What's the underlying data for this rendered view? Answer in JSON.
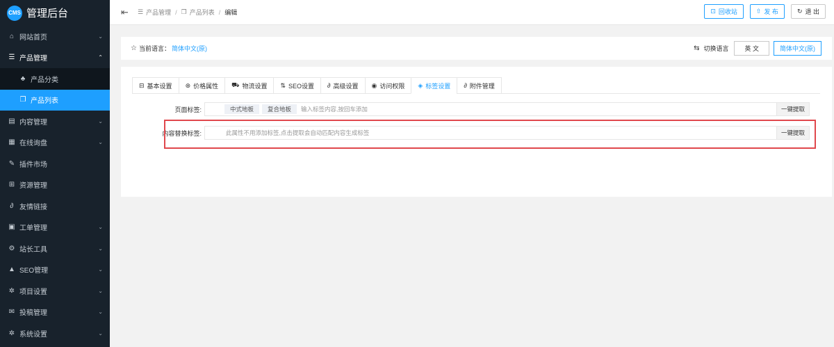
{
  "brand": {
    "logo": "CMS",
    "title": "管理后台"
  },
  "sidebar": {
    "items": [
      {
        "label": "网站首页",
        "icon": "home-icon",
        "arrow": "down"
      },
      {
        "label": "产品管理",
        "icon": "list-icon",
        "arrow": "up",
        "open": true
      },
      {
        "label": "内容管理",
        "icon": "content-icon",
        "arrow": "down"
      },
      {
        "label": "在线询盘",
        "icon": "inquiry-icon",
        "arrow": "down"
      },
      {
        "label": "插件市场",
        "icon": "pin-icon"
      },
      {
        "label": "资源管理",
        "icon": "grid-icon"
      },
      {
        "label": "友情链接",
        "icon": "link-icon"
      },
      {
        "label": "工单管理",
        "icon": "ticket-icon",
        "arrow": "down"
      },
      {
        "label": "站长工具",
        "icon": "tools-icon",
        "arrow": "down"
      },
      {
        "label": "SEO管理",
        "icon": "warning-icon",
        "arrow": "down"
      },
      {
        "label": "项目设置",
        "icon": "gear-icon",
        "arrow": "down"
      },
      {
        "label": "投稿管理",
        "icon": "mail-icon",
        "arrow": "down"
      },
      {
        "label": "系统设置",
        "icon": "gear-icon",
        "arrow": "down"
      }
    ],
    "sub_items": [
      {
        "label": "产品分类",
        "icon": "category-icon"
      },
      {
        "label": "产品列表",
        "icon": "copy-icon",
        "active": true
      }
    ]
  },
  "header": {
    "breadcrumb": [
      "产品管理",
      "产品列表",
      "编辑"
    ],
    "buttons": {
      "recycle": "回收站",
      "publish": "发 布",
      "logout": "退 出"
    }
  },
  "language": {
    "current_label": "当前语言：",
    "current_value": "简体中文(原)",
    "switch_label": "切换语言",
    "options": [
      "英 文",
      "简体中文(原)"
    ]
  },
  "tabs": [
    "基本设置",
    "价格属性",
    "物流设置",
    "SEO设置",
    "高级设置",
    "访问权限",
    "标签设置",
    "附件管理"
  ],
  "active_tab": "标签设置",
  "form": {
    "page_tags": {
      "label": "页面标签:",
      "tags": [
        "中式地板",
        "复合地板"
      ],
      "placeholder": "输入标签内容,按回车添加",
      "button": "一键提取"
    },
    "content_replace_tags": {
      "label": "内容替换标签:",
      "placeholder": "此属性不用添加标签,点击提取会自动匹配内容生成标签",
      "button": "一键提取"
    }
  },
  "colors": {
    "accent": "#1e9fff",
    "sidebar_bg": "#18222c",
    "highlight": "#e0474c"
  }
}
